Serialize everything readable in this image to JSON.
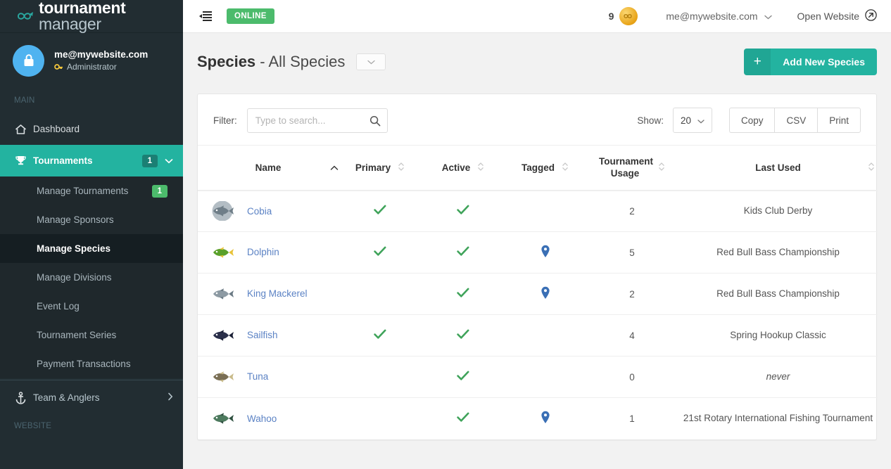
{
  "brand": {
    "name_bold": "tournament",
    "name_thin": " manager",
    "logo_icon": "infinity-fish-logo-icon"
  },
  "sidebar": {
    "user": {
      "email": "me@mywebsite.com",
      "role": "Administrator",
      "role_icon": "key-icon",
      "avatar_icon": "lock-icon"
    },
    "sections": [
      {
        "header": "MAIN"
      },
      {
        "header": "WEBSITE"
      }
    ],
    "main_header": "MAIN",
    "website_header": "WEBSITE",
    "items": [
      {
        "label": "Dashboard",
        "icon": "home-icon",
        "badge": "",
        "active": false
      },
      {
        "label": "Tournaments",
        "icon": "trophy-icon",
        "badge": "1",
        "active": true,
        "chevron": "chevron-down-icon"
      }
    ],
    "sub_items": [
      {
        "label": "Manage Tournaments",
        "badge": "1",
        "current": false
      },
      {
        "label": "Manage Sponsors",
        "badge": "",
        "current": false
      },
      {
        "label": "Manage Species",
        "badge": "",
        "current": true
      },
      {
        "label": "Manage Divisions",
        "badge": "",
        "current": false
      },
      {
        "label": "Event Log",
        "badge": "",
        "current": false
      },
      {
        "label": "Tournament Series",
        "badge": "",
        "current": false
      },
      {
        "label": "Payment Transactions",
        "badge": "",
        "current": false
      }
    ],
    "team_anglers": {
      "label": "Team & Anglers",
      "icon": "anchor-icon",
      "chevron": "chevron-right-icon"
    }
  },
  "topbar": {
    "toggle_icon": "sidebar-collapse-icon",
    "status_badge": "ONLINE",
    "coin_count": "9",
    "coin_icon": "gold-coin-icon",
    "user_email": "me@mywebsite.com",
    "user_chevron": "chevron-down-icon",
    "open_website": "Open Website",
    "open_website_icon": "external-link-icon"
  },
  "page": {
    "title_bold": "Species",
    "title_rest": " - All Species",
    "title_dropdown_icon": "chevron-down-icon",
    "add_button": {
      "label": "Add New Species",
      "icon": "plus-icon"
    }
  },
  "toolbar": {
    "filter_label": "Filter:",
    "filter_placeholder": "Type to search...",
    "filter_value": "",
    "search_icon": "search-icon",
    "show_label": "Show:",
    "show_value": "20",
    "show_chevron": "chevron-down-icon",
    "export_buttons": [
      "Copy",
      "CSV",
      "Print"
    ]
  },
  "table": {
    "columns": [
      {
        "label": "Name",
        "sort": "asc",
        "align": "left"
      },
      {
        "label": "Primary",
        "sort": "none",
        "align": "center"
      },
      {
        "label": "Active",
        "sort": "none",
        "align": "center"
      },
      {
        "label": "Tagged",
        "sort": "none",
        "align": "center"
      },
      {
        "label": "Tournament Usage",
        "sort": "none",
        "align": "center"
      },
      {
        "label": "Last Used",
        "sort": "none",
        "align": "center"
      }
    ],
    "rows": [
      {
        "name": "Cobia",
        "thumb": "cobia-fish-icon",
        "primary": true,
        "active": true,
        "tagged": false,
        "usage": "2",
        "last_used": "Kids Club Derby",
        "never": false
      },
      {
        "name": "Dolphin",
        "thumb": "dolphin-fish-icon",
        "primary": true,
        "active": true,
        "tagged": true,
        "usage": "5",
        "last_used": "Red Bull Bass Championship",
        "never": false
      },
      {
        "name": "King Mackerel",
        "thumb": "king-mackerel-fish-icon",
        "primary": false,
        "active": true,
        "tagged": true,
        "usage": "2",
        "last_used": "Red Bull Bass Championship",
        "never": false
      },
      {
        "name": "Sailfish",
        "thumb": "sailfish-fish-icon",
        "primary": true,
        "active": true,
        "tagged": false,
        "usage": "4",
        "last_used": "Spring Hookup Classic",
        "never": false
      },
      {
        "name": "Tuna",
        "thumb": "tuna-fish-icon",
        "primary": false,
        "active": true,
        "tagged": false,
        "usage": "0",
        "last_used": "never",
        "never": true
      },
      {
        "name": "Wahoo",
        "thumb": "wahoo-fish-icon",
        "primary": false,
        "active": true,
        "tagged": true,
        "usage": "1",
        "last_used": "21st Rotary International Fishing Tournament",
        "never": false
      }
    ]
  },
  "colors": {
    "sidebar_bg": "#222d32",
    "accent_teal": "#23b3a0",
    "green": "#4cbb6c",
    "link_blue": "#5b82c4",
    "check_green": "#3fa35a",
    "pin_blue": "#3a6fb5"
  }
}
